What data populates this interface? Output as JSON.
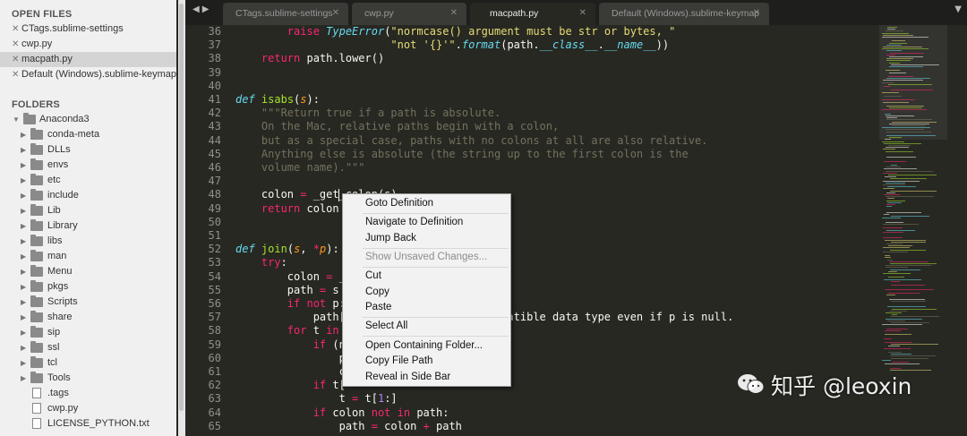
{
  "sidebar": {
    "open_files_header": "OPEN FILES",
    "folders_header": "FOLDERS",
    "open_files": [
      {
        "label": "CTags.sublime-settings",
        "active": false
      },
      {
        "label": "cwp.py",
        "active": false
      },
      {
        "label": "macpath.py",
        "active": true
      },
      {
        "label": "Default (Windows).sublime-keymap",
        "active": false
      }
    ],
    "root_folder": "Anaconda3",
    "tree": [
      {
        "label": "conda-meta",
        "kind": "folder"
      },
      {
        "label": "DLLs",
        "kind": "folder"
      },
      {
        "label": "envs",
        "kind": "folder"
      },
      {
        "label": "etc",
        "kind": "folder"
      },
      {
        "label": "include",
        "kind": "folder"
      },
      {
        "label": "Lib",
        "kind": "folder"
      },
      {
        "label": "Library",
        "kind": "folder"
      },
      {
        "label": "libs",
        "kind": "folder"
      },
      {
        "label": "man",
        "kind": "folder"
      },
      {
        "label": "Menu",
        "kind": "folder"
      },
      {
        "label": "pkgs",
        "kind": "folder"
      },
      {
        "label": "Scripts",
        "kind": "folder"
      },
      {
        "label": "share",
        "kind": "folder"
      },
      {
        "label": "sip",
        "kind": "folder"
      },
      {
        "label": "ssl",
        "kind": "folder"
      },
      {
        "label": "tcl",
        "kind": "folder"
      },
      {
        "label": "Tools",
        "kind": "folder"
      },
      {
        "label": ".tags",
        "kind": "file"
      },
      {
        "label": "cwp.py",
        "kind": "file"
      },
      {
        "label": "LICENSE_PYTHON.txt",
        "kind": "file"
      }
    ]
  },
  "tabs": [
    {
      "label": "CTags.sublime-settings",
      "active": false
    },
    {
      "label": "cwp.py",
      "active": false
    },
    {
      "label": "macpath.py",
      "active": true
    },
    {
      "label": "Default (Windows).sublime-keymap",
      "active": false
    }
  ],
  "editor": {
    "line_numbers": [
      "36",
      "37",
      "38",
      "39",
      "40",
      "41",
      "42",
      "43",
      "44",
      "45",
      "46",
      "47",
      "48",
      "49",
      "50",
      "51",
      "52",
      "53",
      "54",
      "55",
      "56",
      "57",
      "58",
      "59",
      "60",
      "61",
      "62",
      "63",
      "64",
      "65"
    ]
  },
  "context_menu": {
    "items": [
      {
        "label": "Goto Definition",
        "enabled": true
      },
      {
        "label": "Navigate to Definition",
        "enabled": true
      },
      {
        "label": "Jump Back",
        "enabled": true
      },
      {
        "label": "Show Unsaved Changes...",
        "enabled": false
      },
      {
        "label": "Cut",
        "enabled": true
      },
      {
        "label": "Copy",
        "enabled": true
      },
      {
        "label": "Paste",
        "enabled": true
      },
      {
        "label": "Select All",
        "enabled": true
      },
      {
        "label": "Open Containing Folder...",
        "enabled": true
      },
      {
        "label": "Copy File Path",
        "enabled": true
      },
      {
        "label": "Reveal in Side Bar",
        "enabled": true
      }
    ]
  },
  "watermark": {
    "text": "知乎 @leoxin",
    "logo_icon": "wechat-icon"
  },
  "colors": {
    "editor_bg": "#272822",
    "keyword": "#f92672",
    "string": "#e6db74",
    "function": "#a6e22e",
    "comment": "#75715e",
    "builtin": "#66d9ef"
  }
}
